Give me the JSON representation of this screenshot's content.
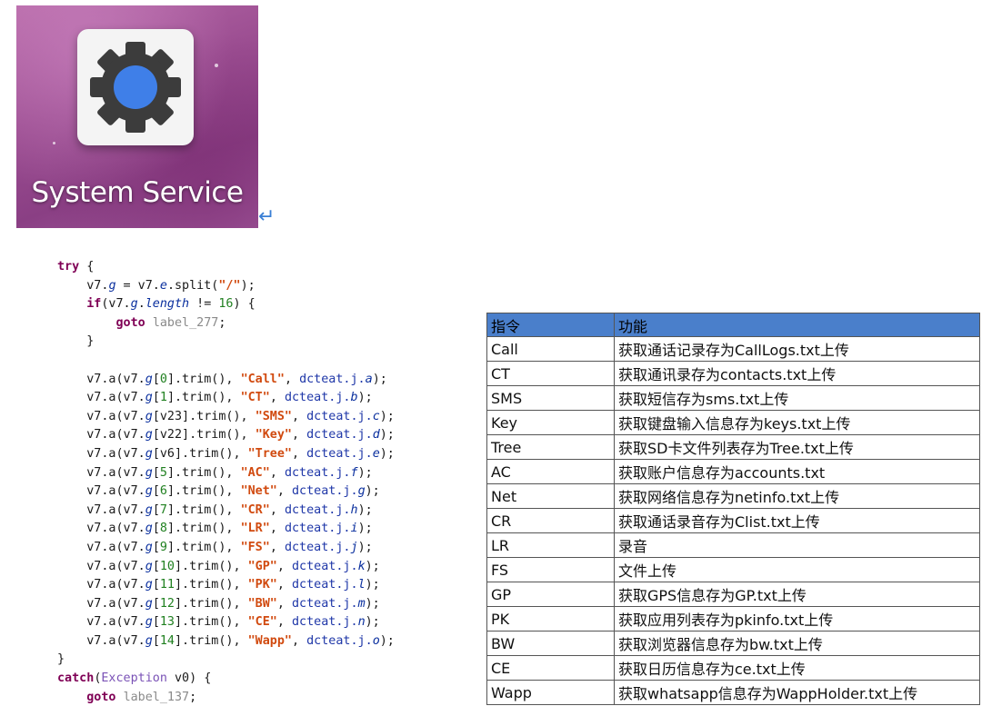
{
  "app": {
    "name": "System Service",
    "icon": "gear-icon",
    "colors": {
      "gear": "#3c3c3c",
      "gear_center": "#3f7fe8",
      "tile": "#f4f4f4"
    }
  },
  "code": {
    "lines": [
      [
        {
          "c": "kw",
          "t": "try"
        },
        {
          "t": " {"
        }
      ],
      [
        {
          "t": "    v7."
        },
        {
          "c": "fld",
          "t": "g"
        },
        {
          "t": " = v7."
        },
        {
          "c": "fld",
          "t": "e"
        },
        {
          "t": ".split("
        },
        {
          "c": "str",
          "t": "\"/\""
        },
        {
          "t": ");"
        }
      ],
      [
        {
          "t": "    "
        },
        {
          "c": "kw",
          "t": "if"
        },
        {
          "t": "(v7."
        },
        {
          "c": "fld",
          "t": "g"
        },
        {
          "t": "."
        },
        {
          "c": "fld",
          "t": "length"
        },
        {
          "t": " != "
        },
        {
          "c": "num",
          "t": "16"
        },
        {
          "t": ") {"
        }
      ],
      [
        {
          "t": "        "
        },
        {
          "c": "kw",
          "t": "goto"
        },
        {
          "t": " "
        },
        {
          "c": "lbl",
          "t": "label_277"
        },
        {
          "t": ";"
        }
      ],
      [
        {
          "t": "    }"
        }
      ],
      [
        {
          "t": ""
        }
      ],
      [
        {
          "t": "    v7.a(v7."
        },
        {
          "c": "fld",
          "t": "g"
        },
        {
          "t": "["
        },
        {
          "c": "num",
          "t": "0"
        },
        {
          "t": "].trim(), "
        },
        {
          "c": "str",
          "t": "\"Call\""
        },
        {
          "t": ", "
        },
        {
          "c": "cls",
          "t": "dcteat.j."
        },
        {
          "c": "fld",
          "t": "a"
        },
        {
          "t": ");"
        }
      ],
      [
        {
          "t": "    v7.a(v7."
        },
        {
          "c": "fld",
          "t": "g"
        },
        {
          "t": "["
        },
        {
          "c": "num",
          "t": "1"
        },
        {
          "t": "].trim(), "
        },
        {
          "c": "str",
          "t": "\"CT\""
        },
        {
          "t": ", "
        },
        {
          "c": "cls",
          "t": "dcteat.j."
        },
        {
          "c": "fld",
          "t": "b"
        },
        {
          "t": ");"
        }
      ],
      [
        {
          "t": "    v7.a(v7."
        },
        {
          "c": "fld",
          "t": "g"
        },
        {
          "t": "[v23].trim(), "
        },
        {
          "c": "str",
          "t": "\"SMS\""
        },
        {
          "t": ", "
        },
        {
          "c": "cls",
          "t": "dcteat.j."
        },
        {
          "c": "fld",
          "t": "c"
        },
        {
          "t": ");"
        }
      ],
      [
        {
          "t": "    v7.a(v7."
        },
        {
          "c": "fld",
          "t": "g"
        },
        {
          "t": "[v22].trim(), "
        },
        {
          "c": "str",
          "t": "\"Key\""
        },
        {
          "t": ", "
        },
        {
          "c": "cls",
          "t": "dcteat.j."
        },
        {
          "c": "fld",
          "t": "d"
        },
        {
          "t": ");"
        }
      ],
      [
        {
          "t": "    v7.a(v7."
        },
        {
          "c": "fld",
          "t": "g"
        },
        {
          "t": "[v6].trim(), "
        },
        {
          "c": "str",
          "t": "\"Tree\""
        },
        {
          "t": ", "
        },
        {
          "c": "cls",
          "t": "dcteat.j."
        },
        {
          "c": "fld",
          "t": "e"
        },
        {
          "t": ");"
        }
      ],
      [
        {
          "t": "    v7.a(v7."
        },
        {
          "c": "fld",
          "t": "g"
        },
        {
          "t": "["
        },
        {
          "c": "num",
          "t": "5"
        },
        {
          "t": "].trim(), "
        },
        {
          "c": "str",
          "t": "\"AC\""
        },
        {
          "t": ", "
        },
        {
          "c": "cls",
          "t": "dcteat.j."
        },
        {
          "c": "fld",
          "t": "f"
        },
        {
          "t": ");"
        }
      ],
      [
        {
          "t": "    v7.a(v7."
        },
        {
          "c": "fld",
          "t": "g"
        },
        {
          "t": "["
        },
        {
          "c": "num",
          "t": "6"
        },
        {
          "t": "].trim(), "
        },
        {
          "c": "str",
          "t": "\"Net\""
        },
        {
          "t": ", "
        },
        {
          "c": "cls",
          "t": "dcteat.j."
        },
        {
          "c": "fld",
          "t": "g"
        },
        {
          "t": ");"
        }
      ],
      [
        {
          "t": "    v7.a(v7."
        },
        {
          "c": "fld",
          "t": "g"
        },
        {
          "t": "["
        },
        {
          "c": "num",
          "t": "7"
        },
        {
          "t": "].trim(), "
        },
        {
          "c": "str",
          "t": "\"CR\""
        },
        {
          "t": ", "
        },
        {
          "c": "cls",
          "t": "dcteat.j."
        },
        {
          "c": "fld",
          "t": "h"
        },
        {
          "t": ");"
        }
      ],
      [
        {
          "t": "    v7.a(v7."
        },
        {
          "c": "fld",
          "t": "g"
        },
        {
          "t": "["
        },
        {
          "c": "num",
          "t": "8"
        },
        {
          "t": "].trim(), "
        },
        {
          "c": "str",
          "t": "\"LR\""
        },
        {
          "t": ", "
        },
        {
          "c": "cls",
          "t": "dcteat.j."
        },
        {
          "c": "fld",
          "t": "i"
        },
        {
          "t": ");"
        }
      ],
      [
        {
          "t": "    v7.a(v7."
        },
        {
          "c": "fld",
          "t": "g"
        },
        {
          "t": "["
        },
        {
          "c": "num",
          "t": "9"
        },
        {
          "t": "].trim(), "
        },
        {
          "c": "str",
          "t": "\"FS\""
        },
        {
          "t": ", "
        },
        {
          "c": "cls",
          "t": "dcteat.j."
        },
        {
          "c": "fld",
          "t": "j"
        },
        {
          "t": ");"
        }
      ],
      [
        {
          "t": "    v7.a(v7."
        },
        {
          "c": "fld",
          "t": "g"
        },
        {
          "t": "["
        },
        {
          "c": "num",
          "t": "10"
        },
        {
          "t": "].trim(), "
        },
        {
          "c": "str",
          "t": "\"GP\""
        },
        {
          "t": ", "
        },
        {
          "c": "cls",
          "t": "dcteat.j."
        },
        {
          "c": "fld",
          "t": "k"
        },
        {
          "t": ");"
        }
      ],
      [
        {
          "t": "    v7.a(v7."
        },
        {
          "c": "fld",
          "t": "g"
        },
        {
          "t": "["
        },
        {
          "c": "num",
          "t": "11"
        },
        {
          "t": "].trim(), "
        },
        {
          "c": "str",
          "t": "\"PK\""
        },
        {
          "t": ", "
        },
        {
          "c": "cls",
          "t": "dcteat.j."
        },
        {
          "c": "fld",
          "t": "l"
        },
        {
          "t": ");"
        }
      ],
      [
        {
          "t": "    v7.a(v7."
        },
        {
          "c": "fld",
          "t": "g"
        },
        {
          "t": "["
        },
        {
          "c": "num",
          "t": "12"
        },
        {
          "t": "].trim(), "
        },
        {
          "c": "str",
          "t": "\"BW\""
        },
        {
          "t": ", "
        },
        {
          "c": "cls",
          "t": "dcteat.j."
        },
        {
          "c": "fld",
          "t": "m"
        },
        {
          "t": ");"
        }
      ],
      [
        {
          "t": "    v7.a(v7."
        },
        {
          "c": "fld",
          "t": "g"
        },
        {
          "t": "["
        },
        {
          "c": "num",
          "t": "13"
        },
        {
          "t": "].trim(), "
        },
        {
          "c": "str",
          "t": "\"CE\""
        },
        {
          "t": ", "
        },
        {
          "c": "cls",
          "t": "dcteat.j."
        },
        {
          "c": "fld",
          "t": "n"
        },
        {
          "t": ");"
        }
      ],
      [
        {
          "t": "    v7.a(v7."
        },
        {
          "c": "fld",
          "t": "g"
        },
        {
          "t": "["
        },
        {
          "c": "num",
          "t": "14"
        },
        {
          "t": "].trim(), "
        },
        {
          "c": "str",
          "t": "\"Wapp\""
        },
        {
          "t": ", "
        },
        {
          "c": "cls",
          "t": "dcteat.j."
        },
        {
          "c": "fld",
          "t": "o"
        },
        {
          "t": ");"
        }
      ],
      [
        {
          "t": "}"
        }
      ],
      [
        {
          "c": "kw",
          "t": "catch"
        },
        {
          "t": "("
        },
        {
          "c": "typ",
          "t": "Exception"
        },
        {
          "t": " v0) {"
        }
      ],
      [
        {
          "t": "    "
        },
        {
          "c": "kw",
          "t": "goto"
        },
        {
          "t": " "
        },
        {
          "c": "lbl",
          "t": "label_137"
        },
        {
          "t": ";"
        }
      ]
    ]
  },
  "table": {
    "headers": [
      "指令",
      "功能"
    ],
    "rows": [
      [
        "Call",
        "获取通话记录存为CallLogs.txt上传"
      ],
      [
        "CT",
        "获取通讯录存为contacts.txt上传"
      ],
      [
        "SMS",
        "获取短信存为sms.txt上传"
      ],
      [
        "Key",
        "获取键盘输入信息存为keys.txt上传"
      ],
      [
        "Tree",
        "获取SD卡文件列表存为Tree.txt上传"
      ],
      [
        "AC",
        "获取账户信息存为accounts.txt"
      ],
      [
        "Net",
        "获取网络信息存为netinfo.txt上传"
      ],
      [
        "CR",
        "获取通话录音存为Clist.txt上传"
      ],
      [
        "LR",
        "录音"
      ],
      [
        "FS",
        "文件上传"
      ],
      [
        "GP",
        "获取GPS信息存为GP.txt上传"
      ],
      [
        "PK",
        "获取应用列表存为pkinfo.txt上传"
      ],
      [
        "BW",
        "获取浏览器信息存为bw.txt上传"
      ],
      [
        "CE",
        "获取日历信息存为ce.txt上传"
      ],
      [
        "Wapp",
        "获取whatsapp信息存为WappHolder.txt上传"
      ]
    ],
    "header_color": "#4a7fcb"
  }
}
